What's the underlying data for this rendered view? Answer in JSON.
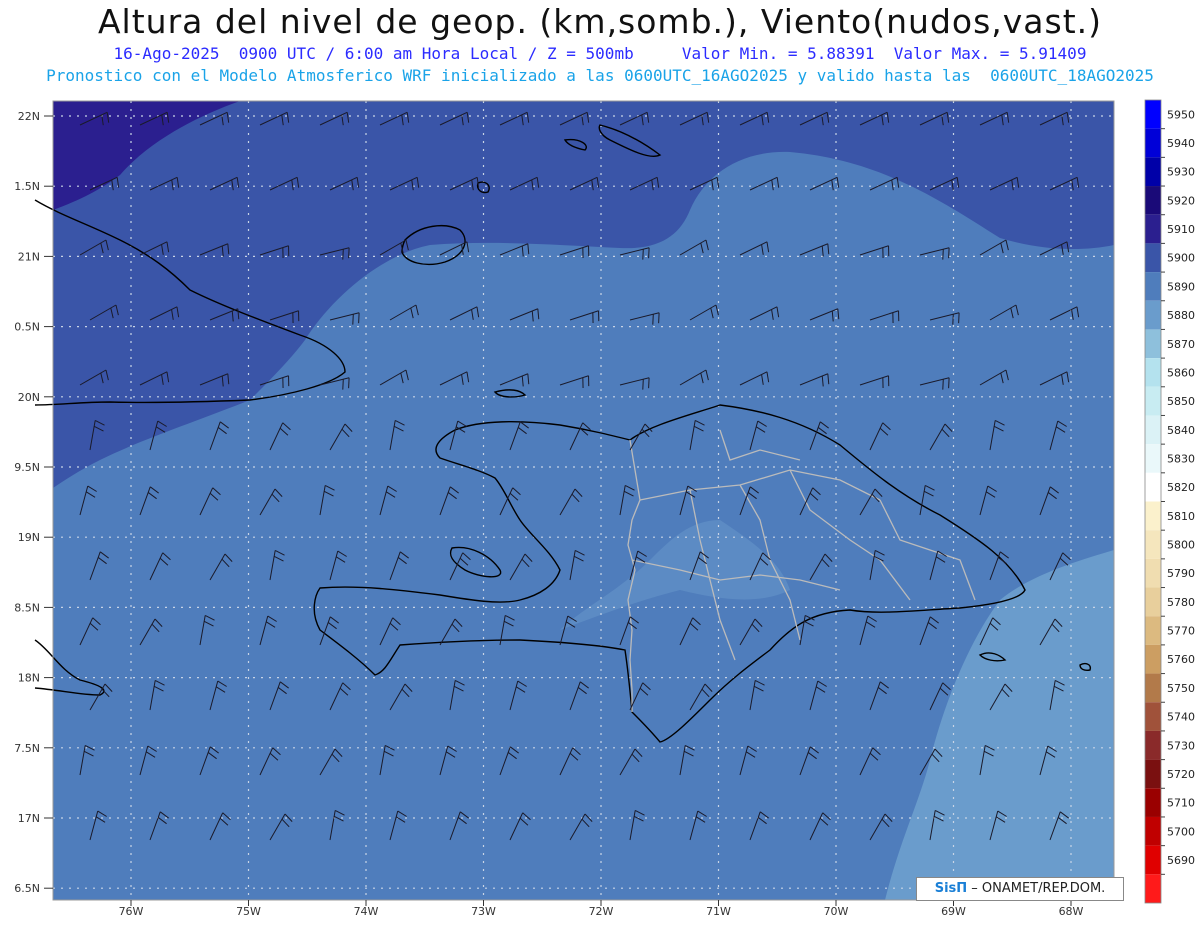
{
  "header": {
    "title": "Altura del nivel de geop. (km,somb.), Viento(nudos,vast.)",
    "line1": "16-Ago-2025  0900 UTC / 6:00 am Hora Local / Z = 500mb     Valor Min. = 5.88391  Valor Max. = 5.91409",
    "line2": "Pronostico con el Modelo Atmosferico WRF inicializado a las 0600UTC_16AGO2025 y valido hasta las  0600UTC_18AGO2025"
  },
  "axes": {
    "lat_labels": [
      "22N",
      "1.5N",
      "21N",
      "0.5N",
      "20N",
      "9.5N",
      "19N",
      "8.5N",
      "18N",
      "7.5N",
      "17N",
      "6.5N"
    ],
    "lon_labels": [
      "76W",
      "75W",
      "74W",
      "73W",
      "72W",
      "71W",
      "70W",
      "69W",
      "68W"
    ]
  },
  "colorbar": {
    "labels": [
      "5950",
      "5940",
      "5930",
      "5920",
      "5910",
      "5900",
      "5890",
      "5880",
      "5870",
      "5860",
      "5850",
      "5840",
      "5830",
      "5820",
      "5810",
      "5800",
      "5790",
      "5780",
      "5770",
      "5760",
      "5750",
      "5740",
      "5730",
      "5720",
      "5710",
      "5700",
      "5690"
    ],
    "colors": [
      "#0000ff",
      "#0000d8",
      "#0000a8",
      "#1a0a78",
      "#2b1f8f",
      "#3a55a8",
      "#4f7dbc",
      "#6a9ccc",
      "#8ec0dc",
      "#b4e2ee",
      "#c8ecf2",
      "#dbf2f6",
      "#eaf8fa",
      "#ffffff",
      "#fbf1cc",
      "#f5e6bd",
      "#f0ddb0",
      "#e8cf9c",
      "#dcba80",
      "#cc9e62",
      "#b27a4a",
      "#a0523a",
      "#8a2a2a",
      "#7a1010",
      "#9a0000",
      "#c00000",
      "#e00000",
      "#ff1a1a"
    ],
    "fills": {
      "deep": "#2b1f8f",
      "band5900": "#3a55a8",
      "band5890": "#4f7dbc",
      "band5880": "#6a9ccc"
    }
  },
  "credit": {
    "brand": "SisΠ",
    "text": " – ONAMET/REP.DOM."
  }
}
